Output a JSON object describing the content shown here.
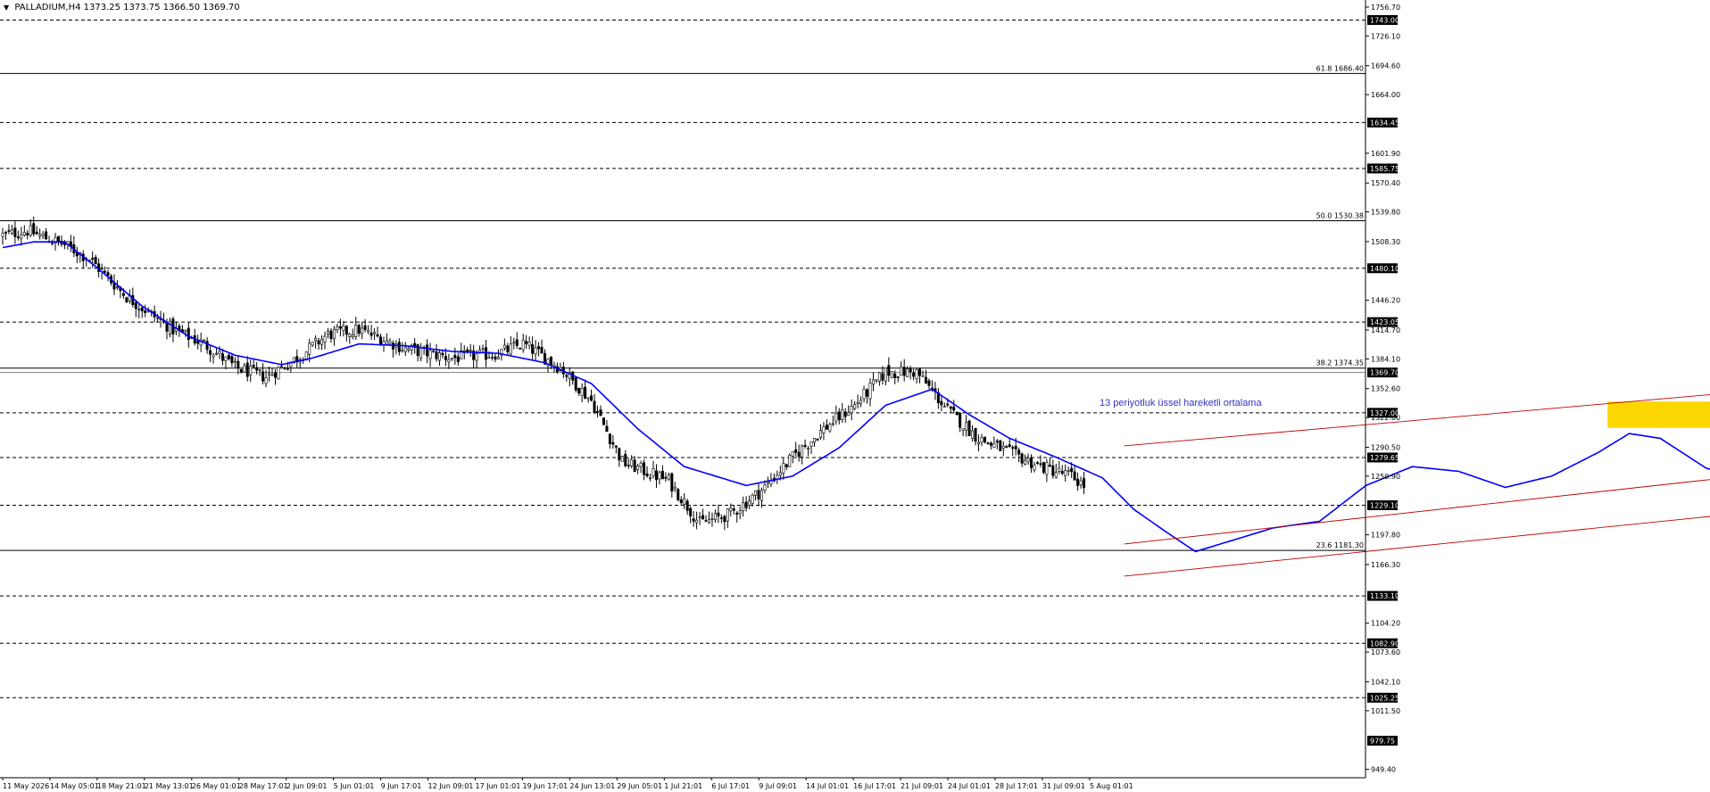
{
  "header": {
    "symbol": "PALLADIUM,H4",
    "ohlc": "1373.25 1373.75 1366.50 1369.70"
  },
  "colors": {
    "background": "#ffffff",
    "candle": "#000000",
    "ema": "#0000ff",
    "channel": "#c00000",
    "zone": "#ffd700",
    "annotation": "#3333cc"
  },
  "chart_data": {
    "type": "candlestick",
    "ylim": [
      940.5,
      1764.2
    ],
    "ema_label": "13 periyotluk üssel hareketli ortalama",
    "price_ticks": [
      "1756.70",
      "1726.10",
      "1694.60",
      "1664.00",
      "1601.90",
      "1570.40",
      "1539.80",
      "1508.30",
      "1446.20",
      "1414.70",
      "1384.10",
      "1352.60",
      "1322.00",
      "1290.50",
      "1259.90",
      "1197.80",
      "1166.30",
      "1104.20",
      "1073.60",
      "1042.10",
      "1011.50",
      "949.40"
    ],
    "level_labels": [
      {
        "value": 1743.0,
        "text": "1743.00"
      },
      {
        "value": 1634.45,
        "text": "1634.45"
      },
      {
        "value": 1585.75,
        "text": "1585.75"
      },
      {
        "value": 1480.1,
        "text": "1480.10"
      },
      {
        "value": 1423.05,
        "text": "1423.05"
      },
      {
        "value": 1369.7,
        "text": "1369.70"
      },
      {
        "value": 1327.0,
        "text": "1327.00"
      },
      {
        "value": 1279.65,
        "text": "1279.65"
      },
      {
        "value": 1229.1,
        "text": "1229.10"
      },
      {
        "value": 1133.1,
        "text": "1133.10"
      },
      {
        "value": 1082.9,
        "text": "1082.90"
      },
      {
        "value": 1025.25,
        "text": "1025.25"
      },
      {
        "value": 979.75,
        "text": "979.75"
      }
    ],
    "dashed_levels": [
      1743.0,
      1634.45,
      1585.75,
      1480.1,
      1423.05,
      1327.0,
      1279.65,
      1229.1,
      1133.1,
      1082.9,
      1025.25
    ],
    "fib_levels": [
      {
        "value": 1686.4,
        "text": "61.8 1686.40"
      },
      {
        "value": 1530.38,
        "text": "50.0 1530.38"
      },
      {
        "value": 1374.35,
        "text": "38.2 1374.35"
      },
      {
        "value": 1181.3,
        "text": "23.6 1181.30"
      }
    ],
    "time_labels": [
      "11 May 2026",
      "14 May 05:01",
      "18 May 21:01",
      "21 May 13:01",
      "26 May 01:01",
      "28 May 17:01",
      "2 Jun 09:01",
      "5 Jun 01:01",
      "9 Jun 17:01",
      "12 Jun 09:01",
      "17 Jun 01:01",
      "19 Jun 17:01",
      "24 Jun 13:01",
      "29 Jun 05:01",
      "1 Jul 21:01",
      "6 Jul 17:01",
      "9 Jul 09:01",
      "14 Jul 01:01",
      "16 Jul 17:01",
      "21 Jul 09:01",
      "24 Jul 01:01",
      "28 Jul 17:01",
      "31 Jul 09:01",
      "5 Aug 01:01"
    ],
    "bars": 350,
    "close_path": [
      [
        0,
        1515
      ],
      [
        8,
        1520
      ],
      [
        14,
        1512
      ],
      [
        20,
        1505
      ],
      [
        28,
        1490
      ],
      [
        40,
        1450
      ],
      [
        55,
        1415
      ],
      [
        65,
        1400
      ],
      [
        75,
        1375
      ],
      [
        85,
        1365
      ],
      [
        95,
        1385
      ],
      [
        105,
        1410
      ],
      [
        115,
        1415
      ],
      [
        130,
        1395
      ],
      [
        145,
        1385
      ],
      [
        160,
        1390
      ],
      [
        168,
        1400
      ],
      [
        180,
        1375
      ],
      [
        190,
        1340
      ],
      [
        200,
        1275
      ],
      [
        215,
        1255
      ],
      [
        225,
        1210
      ],
      [
        235,
        1220
      ],
      [
        245,
        1245
      ],
      [
        255,
        1280
      ],
      [
        265,
        1310
      ],
      [
        275,
        1335
      ],
      [
        285,
        1370
      ],
      [
        295,
        1370
      ],
      [
        305,
        1330
      ],
      [
        315,
        1300
      ],
      [
        325,
        1285
      ],
      [
        335,
        1270
      ],
      [
        345,
        1260
      ],
      [
        355,
        1235
      ],
      [
        362,
        1220
      ],
      [
        366,
        1175
      ],
      [
        372,
        1170
      ],
      [
        378,
        1175
      ],
      [
        385,
        1205
      ],
      [
        395,
        1215
      ],
      [
        405,
        1210
      ],
      [
        415,
        1205
      ],
      [
        425,
        1230
      ],
      [
        432,
        1270
      ],
      [
        440,
        1290
      ],
      [
        450,
        1285
      ],
      [
        460,
        1280
      ],
      [
        468,
        1250
      ],
      [
        475,
        1225
      ],
      [
        482,
        1240
      ],
      [
        490,
        1255
      ],
      [
        500,
        1270
      ],
      [
        510,
        1270
      ],
      [
        518,
        1310
      ],
      [
        528,
        1315
      ],
      [
        535,
        1300
      ],
      [
        545,
        1255
      ],
      [
        555,
        1240
      ],
      [
        565,
        1250
      ],
      [
        575,
        1275
      ],
      [
        585,
        1315
      ],
      [
        592,
        1320
      ],
      [
        600,
        1290
      ],
      [
        610,
        1265
      ],
      [
        620,
        1255
      ],
      [
        630,
        1250
      ],
      [
        640,
        1265
      ],
      [
        650,
        1262
      ],
      [
        660,
        1252
      ],
      [
        670,
        1265
      ],
      [
        678,
        1300
      ],
      [
        684,
        1275
      ],
      [
        690,
        1290
      ],
      [
        696,
        1345
      ],
      [
        702,
        1372
      ],
      [
        706,
        1370
      ]
    ],
    "ema_path": [
      [
        0,
        1502
      ],
      [
        10,
        1508
      ],
      [
        20,
        1508
      ],
      [
        30,
        1482
      ],
      [
        45,
        1440
      ],
      [
        60,
        1408
      ],
      [
        75,
        1388
      ],
      [
        90,
        1378
      ],
      [
        100,
        1385
      ],
      [
        115,
        1400
      ],
      [
        130,
        1398
      ],
      [
        145,
        1392
      ],
      [
        160,
        1390
      ],
      [
        175,
        1380
      ],
      [
        190,
        1358
      ],
      [
        205,
        1310
      ],
      [
        220,
        1270
      ],
      [
        240,
        1250
      ],
      [
        255,
        1260
      ],
      [
        270,
        1290
      ],
      [
        285,
        1335
      ],
      [
        300,
        1352
      ],
      [
        312,
        1325
      ],
      [
        325,
        1300
      ],
      [
        340,
        1280
      ],
      [
        355,
        1258
      ],
      [
        365,
        1225
      ],
      [
        375,
        1202
      ],
      [
        385,
        1180
      ],
      [
        395,
        1190
      ],
      [
        410,
        1205
      ],
      [
        425,
        1212
      ],
      [
        440,
        1250
      ],
      [
        455,
        1270
      ],
      [
        470,
        1265
      ],
      [
        485,
        1248
      ],
      [
        500,
        1260
      ],
      [
        515,
        1285
      ],
      [
        525,
        1305
      ],
      [
        535,
        1300
      ],
      [
        550,
        1268
      ],
      [
        565,
        1260
      ],
      [
        580,
        1290
      ],
      [
        592,
        1305
      ],
      [
        600,
        1292
      ],
      [
        615,
        1268
      ],
      [
        630,
        1270
      ],
      [
        645,
        1272
      ],
      [
        660,
        1268
      ],
      [
        675,
        1272
      ],
      [
        685,
        1280
      ],
      [
        695,
        1300
      ],
      [
        702,
        1315
      ]
    ],
    "channels": [
      {
        "from": [
          362,
          1292
        ],
        "to": [
          885,
          1442
        ]
      },
      {
        "from": [
          362,
          1188
        ],
        "to": [
          885,
          1377
        ]
      },
      {
        "from": [
          362,
          1154
        ],
        "to": [
          885,
          1329
        ]
      }
    ],
    "zone": {
      "x1": 518,
      "x2": 772,
      "y1": 1311,
      "y2": 1339
    }
  }
}
